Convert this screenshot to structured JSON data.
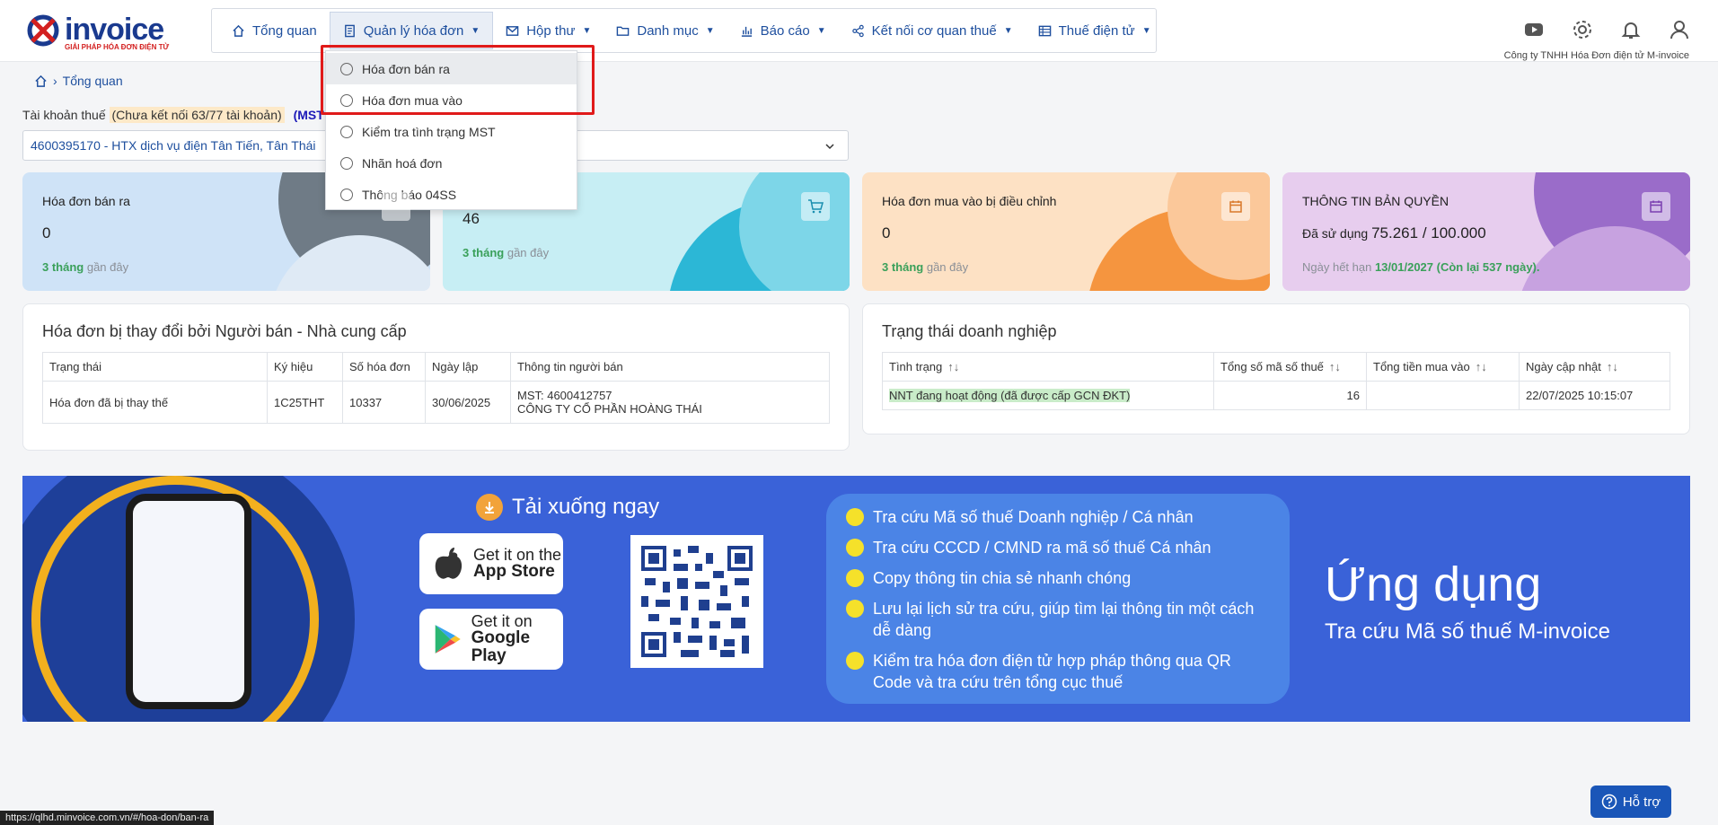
{
  "header": {
    "logo_text": "invoice",
    "logo_sub": "GIẢI PHÁP HÓA ĐƠN ĐIỆN TỬ",
    "company": "Công ty TNHH Hóa Đơn điện tử M-invoice",
    "nav": [
      {
        "label": "Tổng quan"
      },
      {
        "label": "Quản lý hóa đơn"
      },
      {
        "label": "Hộp thư"
      },
      {
        "label": "Danh mục"
      },
      {
        "label": "Báo cáo"
      },
      {
        "label": "Kết nối cơ quan thuế"
      },
      {
        "label": "Thuế điện tử"
      }
    ]
  },
  "dropdown": {
    "items": [
      {
        "label": "Hóa đơn bán ra"
      },
      {
        "label": "Hóa đơn mua vào"
      },
      {
        "label": "Kiểm tra tình trạng MST"
      },
      {
        "label": "Nhãn hoá đơn"
      },
      {
        "label": "Thông báo 04SS"
      }
    ]
  },
  "breadcrumb": {
    "label": "Tổng quan"
  },
  "account": {
    "prefix": "Tài khoản thuế",
    "warning": "(Chưa kết nối 63/77 tài khoản)",
    "mst": "(MST đ",
    "selected": "4600395170 - HTX dịch vụ điện Tân Tiến, Tân Thái"
  },
  "cards": [
    {
      "title": "Hóa đơn bán ra",
      "value": "0",
      "foot_bold": "3 tháng",
      "foot_rest": " gần đây"
    },
    {
      "title": "",
      "value": "46",
      "foot_bold": "3 tháng",
      "foot_rest": " gần đây"
    },
    {
      "title": "Hóa đơn mua vào bị điều chỉnh",
      "value": "0",
      "foot_bold": "3 tháng",
      "foot_rest": " gần đây"
    },
    {
      "title": "THÔNG TIN BẢN QUYỀN",
      "used_prefix": "Đã sử dụng ",
      "used": "75.261 / 100.000",
      "exp_prefix": "Ngày hết hạn ",
      "exp": "13/01/2027 (Còn lại 537 ngày)."
    }
  ],
  "changed": {
    "title": "Hóa đơn bị thay đổi bởi Người bán - Nhà cung cấp",
    "columns": [
      "Trạng thái",
      "Ký hiệu",
      "Số hóa đơn",
      "Ngày lập",
      "Thông tin người bán"
    ],
    "rows": [
      {
        "status": "Hóa đơn đã bị thay thế",
        "symbol": "1C25THT",
        "number": "10337",
        "date": "30/06/2025",
        "mst": "MST: 4600412757",
        "seller": "CÔNG TY CỔ PHẦN HOÀNG THÁI"
      }
    ]
  },
  "business": {
    "title": "Trạng thái doanh nghiệp",
    "columns": [
      "Tình trạng",
      "Tổng số mã số thuế",
      "Tổng tiền mua vào",
      "Ngày cập nhật"
    ],
    "rows": [
      {
        "status": "NNT đang hoạt động (đã được cấp GCN ĐKT)",
        "count": "16",
        "amount": "",
        "updated": "22/07/2025 10:15:07"
      }
    ]
  },
  "banner": {
    "download": "Tải xuống ngay",
    "appstore_t1": "Get it on the",
    "appstore_t2": "App Store",
    "gplay_t1": "Get it on",
    "gplay_t2": "Google Play",
    "features": [
      "Tra cứu Mã số thuế Doanh nghiệp / Cá nhân",
      "Tra cứu CCCD / CMND ra mã số thuế Cá nhân",
      "Copy thông tin chia sẻ nhanh chóng",
      "Lưu lại lịch sử tra cứu, giúp tìm lại thông tin một cách dễ dàng",
      "Kiểm tra hóa đơn điện tử hợp pháp thông qua QR Code và tra cứu trên tổng cục thuế"
    ],
    "app_title": "Ứng dụng",
    "app_sub": "Tra cứu Mã số thuế M-invoice"
  },
  "help": {
    "label": "Hỗ trợ"
  },
  "status_url": "https://qlhd.minvoice.com.vn/#/hoa-don/ban-ra",
  "colors": {
    "accent": "#1e4f9e",
    "highlight_box": "#e01a1a"
  }
}
